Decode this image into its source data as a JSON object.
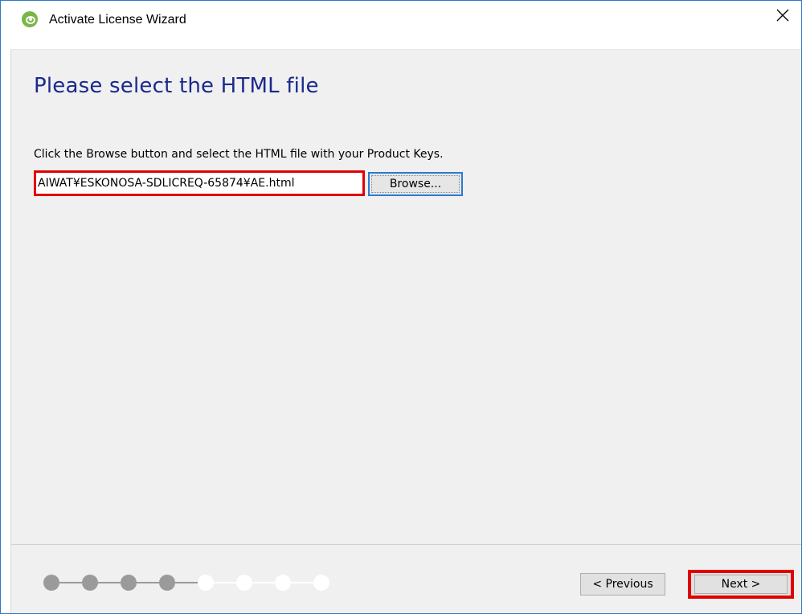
{
  "window": {
    "title": "Activate License Wizard",
    "close_symbol": "✕"
  },
  "page": {
    "title": "Please select the HTML file",
    "instruction": "Click the Browse button and select the HTML file with your Product Keys."
  },
  "file_input": {
    "value": "AIWAT¥ESKONOSA-SDLICREQ-65874¥AE.html"
  },
  "buttons": {
    "browse": "Browse...",
    "previous": "< Previous",
    "next": "Next >"
  },
  "progress": {
    "total_steps": 8,
    "completed_steps": 4
  },
  "colors": {
    "title_text": "#1a2a8c",
    "highlight_red": "#e00000",
    "focus_blue": "#2b7bd4",
    "step_done": "#9a9a9a",
    "step_todo": "#ffffff",
    "app_icon": "#7ab648"
  },
  "icons": {
    "app": "app-logo-icon",
    "close": "close-icon"
  }
}
